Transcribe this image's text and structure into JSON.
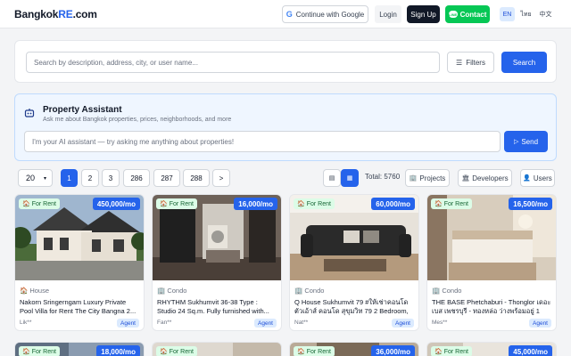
{
  "header": {
    "logo_main": "Bangkok",
    "logo_accent": "RE",
    "logo_suffix": ".com",
    "google_label": "Continue with Google",
    "login_label": "Login",
    "signup_label": "Sign Up",
    "contact_label": "Contact",
    "languages": [
      "EN",
      "ไทย",
      "中文"
    ],
    "active_language": "EN"
  },
  "search": {
    "placeholder": "Search by description, address, city, or user name...",
    "filters_label": "Filters",
    "search_label": "Search"
  },
  "assistant": {
    "title": "Property Assistant",
    "subtitle": "Ask me about Bangkok properties, prices, neighborhoods, and more",
    "placeholder": "I'm your AI assistant — try asking me anything about properties!",
    "send_label": "Send"
  },
  "toolbar": {
    "per_page": "20",
    "pages": [
      "1",
      "2",
      "3",
      "286",
      "287",
      "288",
      ">"
    ],
    "current_page": "1",
    "total_label": "Total: 5760",
    "projects_label": "Projects",
    "developers_label": "Developers",
    "users_label": "Users"
  },
  "listings": [
    {
      "status": "For Rent",
      "price": "450,000/mo",
      "type": "House",
      "title": "Nakorn Sringerngam Luxury Private Pool Villa for Rent The City Bangna 2...",
      "user": "Lik**",
      "badge": "Agent"
    },
    {
      "status": "For Rent",
      "price": "16,000/mo",
      "type": "Condo",
      "title": "RHYTHM Sukhumvit 36-38 Type : Studio 24 Sq.m. Fully furnished with...",
      "user": "Fan**",
      "badge": "Agent"
    },
    {
      "status": "For Rent",
      "price": "60,000/mo",
      "type": "Condo",
      "title": "Q House Sukhumvit 79 #ให้เช่าคอนโด ตัวเอ้าส์ คอนโด สุขุมวิท 79 2 Bedroom, 2...",
      "user": "Nat**",
      "badge": "Agent"
    },
    {
      "status": "For Rent",
      "price": "16,500/mo",
      "type": "Condo",
      "title": "THE BASE Phetchaburi - Thonglor เดอะ เบส เพชรบุรี - ทองหล่อ ว่างพร้อมอยู่ 1 ห้อง...",
      "user": "Mes**",
      "badge": "Agent"
    },
    {
      "status": "For Rent",
      "price": "18,000/mo"
    },
    {
      "status": "For Rent",
      "price": ""
    },
    {
      "status": "For Rent",
      "price": "36,000/mo"
    },
    {
      "status": "For Rent",
      "price": "45,000/mo"
    }
  ],
  "colors": {
    "accent": "#2563eb",
    "line_green": "#06c755",
    "rent_badge_bg": "#dcfce7"
  }
}
